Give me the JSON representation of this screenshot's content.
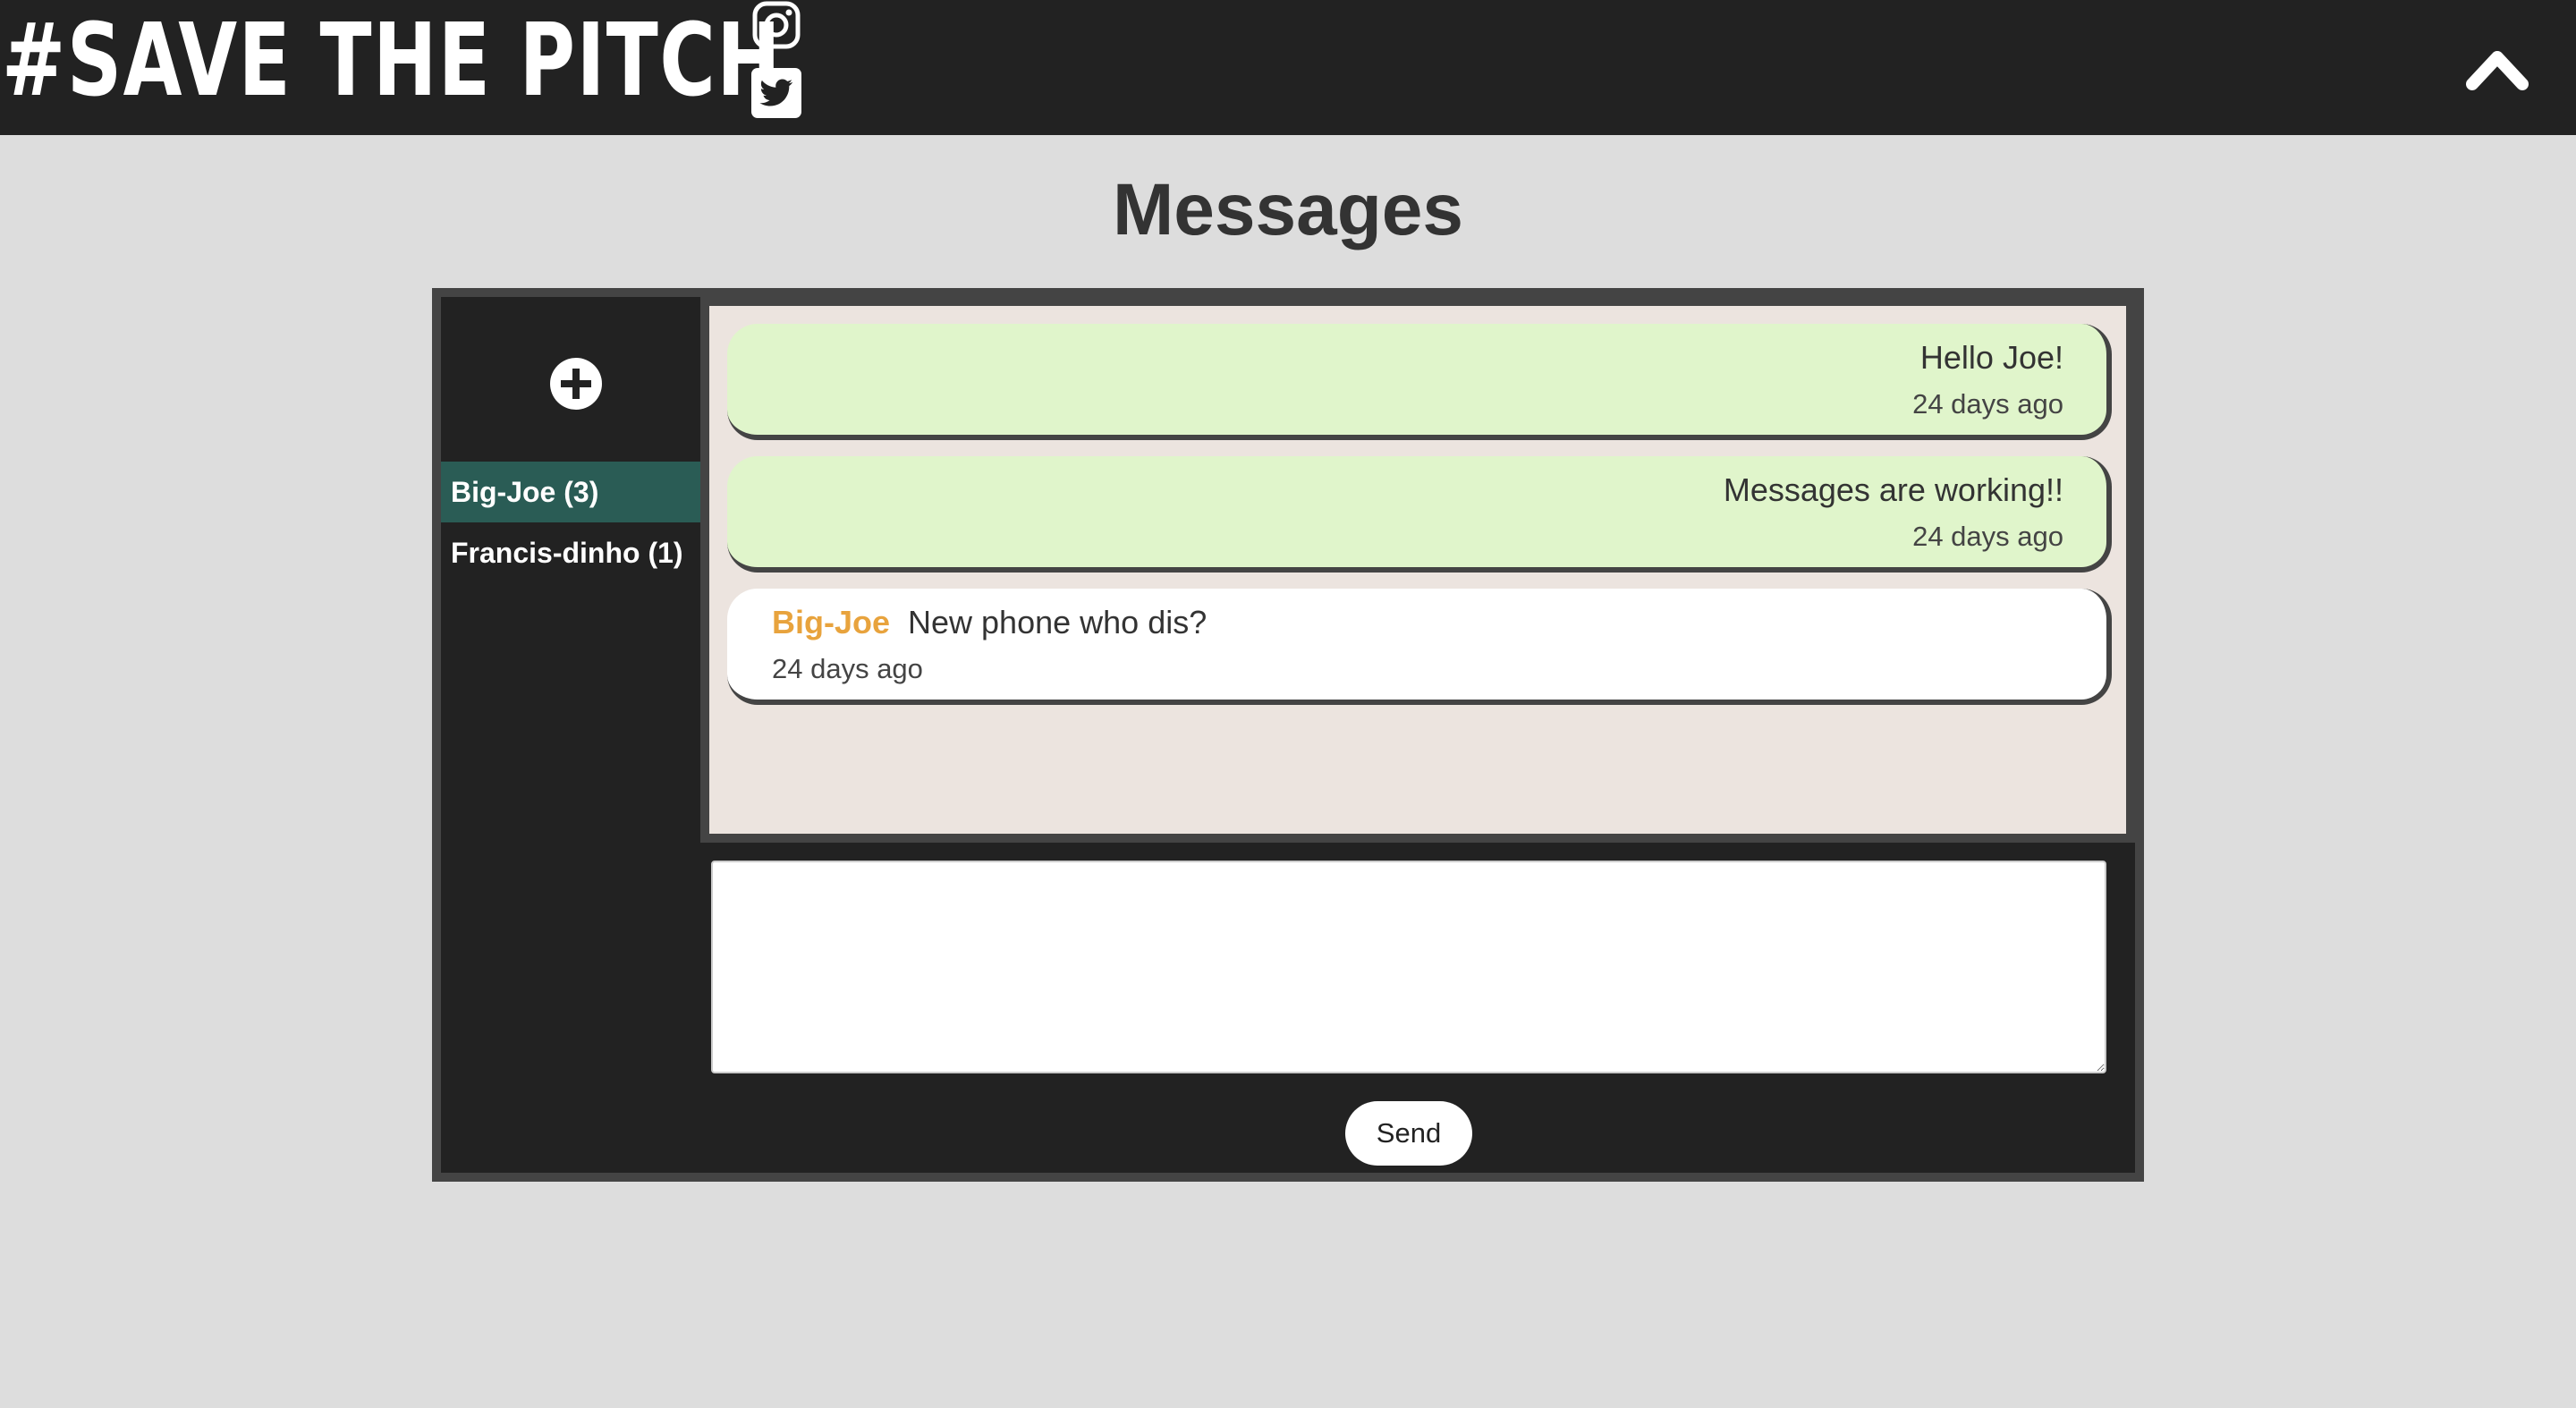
{
  "header": {
    "brand_title": "#SAVE THE PITCH",
    "social_icons": [
      "instagram-icon",
      "twitter-icon"
    ],
    "scroll_top_icon": "chevron-up-icon",
    "colors": {
      "background": "#222222",
      "text": "#ffffff"
    }
  },
  "page": {
    "title": "Messages",
    "background": "#dddddd"
  },
  "sidebar": {
    "new_conversation_icon": "plus-circle-icon",
    "contacts": [
      {
        "label": "Big-Joe (3)",
        "active": true
      },
      {
        "label": "Francis-dinho (1)",
        "active": false
      }
    ],
    "active_color": "#2a5c55"
  },
  "thread": {
    "messages": [
      {
        "direction": "outgoing",
        "text": "Hello Joe!",
        "time": "24 days ago"
      },
      {
        "direction": "outgoing",
        "text": "Messages are working!!",
        "time": "24 days ago"
      },
      {
        "direction": "incoming",
        "sender": "Big-Joe",
        "text": "New phone who dis?",
        "time": "24 days ago"
      }
    ],
    "colors": {
      "outgoing": "#e0f5cb",
      "incoming": "#ffffff",
      "sender": "#e8a33d",
      "background": "#ece4df"
    }
  },
  "composer": {
    "input_value": "",
    "input_placeholder": "",
    "send_label": "Send"
  }
}
